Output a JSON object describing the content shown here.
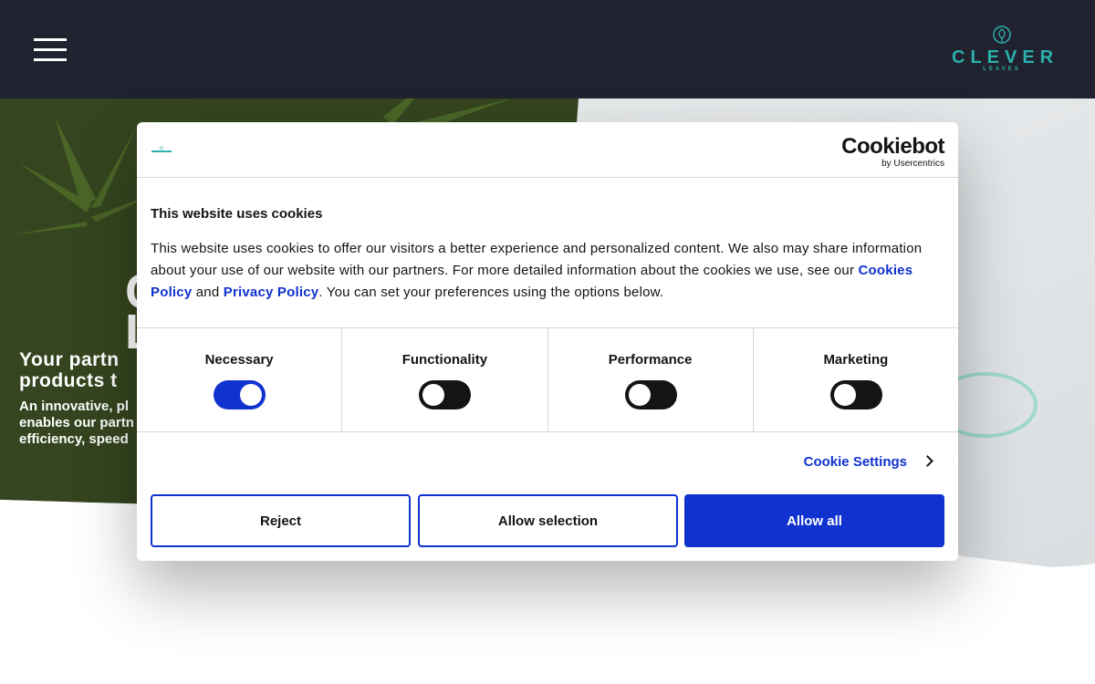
{
  "header": {
    "logo_word": "CLEVER",
    "logo_sub": "LEAVES",
    "menu_icon": "hamburger-menu-icon"
  },
  "hero": {
    "big_letters": "C\nL",
    "heading_line1": "Your partn",
    "heading_line2": "products t",
    "sub_line1": "An innovative, pl",
    "sub_line2": "enables our partn",
    "sub_line3": "efficiency, speed"
  },
  "cookie_modal": {
    "brand": "Cookiebot",
    "brand_sub": "by Usercentrics",
    "title": "This website uses cookies",
    "desc_part1": "This website uses cookies to offer our visitors a better experience and personalized content. We also may share information about your use of our website with our partners. For more detailed information about the cookies we use, see our ",
    "cookies_policy_link": "Cookies Policy",
    "desc_and": " and ",
    "privacy_policy_link": "Privacy Policy",
    "desc_part2": ". You can set your preferences using the options below.",
    "categories": [
      {
        "label": "Necessary",
        "checked": true
      },
      {
        "label": "Functionality",
        "checked": false
      },
      {
        "label": "Performance",
        "checked": false
      },
      {
        "label": "Marketing",
        "checked": false
      }
    ],
    "settings_label": "Cookie Settings",
    "buttons": {
      "reject": "Reject",
      "allow_selection": "Allow selection",
      "allow_all": "Allow all"
    }
  },
  "colors": {
    "header_bg": "#20232f",
    "brand_teal": "#2ab0ad",
    "accent_blue": "#1032cf",
    "toggle_off": "#141414"
  }
}
